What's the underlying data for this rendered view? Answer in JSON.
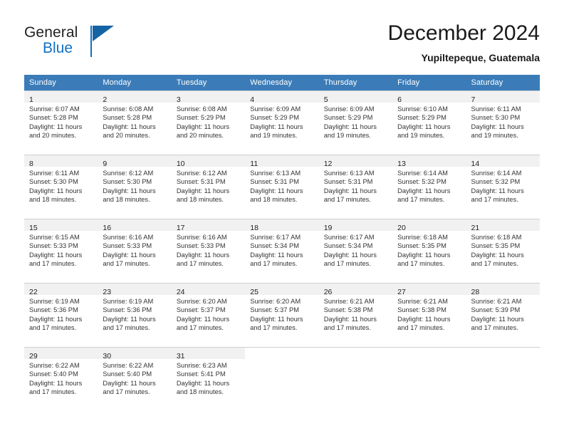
{
  "brand": {
    "name_top": "General",
    "name_bottom": "Blue",
    "accent_color": "#1170c0",
    "triangle_color": "#1464a5"
  },
  "header": {
    "title": "December 2024",
    "subtitle": "Yupiltepeque, Guatemala"
  },
  "calendar": {
    "header_color": "#3b7cb8",
    "daynum_band_color": "#f1f1f1",
    "weekday_headers": [
      "Sunday",
      "Monday",
      "Tuesday",
      "Wednesday",
      "Thursday",
      "Friday",
      "Saturday"
    ],
    "weeks": [
      [
        {
          "day": "1",
          "sunrise": "Sunrise: 6:07 AM",
          "sunset": "Sunset: 5:28 PM",
          "daylight_line1": "Daylight: 11 hours",
          "daylight_line2": "and 20 minutes."
        },
        {
          "day": "2",
          "sunrise": "Sunrise: 6:08 AM",
          "sunset": "Sunset: 5:28 PM",
          "daylight_line1": "Daylight: 11 hours",
          "daylight_line2": "and 20 minutes."
        },
        {
          "day": "3",
          "sunrise": "Sunrise: 6:08 AM",
          "sunset": "Sunset: 5:29 PM",
          "daylight_line1": "Daylight: 11 hours",
          "daylight_line2": "and 20 minutes."
        },
        {
          "day": "4",
          "sunrise": "Sunrise: 6:09 AM",
          "sunset": "Sunset: 5:29 PM",
          "daylight_line1": "Daylight: 11 hours",
          "daylight_line2": "and 19 minutes."
        },
        {
          "day": "5",
          "sunrise": "Sunrise: 6:09 AM",
          "sunset": "Sunset: 5:29 PM",
          "daylight_line1": "Daylight: 11 hours",
          "daylight_line2": "and 19 minutes."
        },
        {
          "day": "6",
          "sunrise": "Sunrise: 6:10 AM",
          "sunset": "Sunset: 5:29 PM",
          "daylight_line1": "Daylight: 11 hours",
          "daylight_line2": "and 19 minutes."
        },
        {
          "day": "7",
          "sunrise": "Sunrise: 6:11 AM",
          "sunset": "Sunset: 5:30 PM",
          "daylight_line1": "Daylight: 11 hours",
          "daylight_line2": "and 19 minutes."
        }
      ],
      [
        {
          "day": "8",
          "sunrise": "Sunrise: 6:11 AM",
          "sunset": "Sunset: 5:30 PM",
          "daylight_line1": "Daylight: 11 hours",
          "daylight_line2": "and 18 minutes."
        },
        {
          "day": "9",
          "sunrise": "Sunrise: 6:12 AM",
          "sunset": "Sunset: 5:30 PM",
          "daylight_line1": "Daylight: 11 hours",
          "daylight_line2": "and 18 minutes."
        },
        {
          "day": "10",
          "sunrise": "Sunrise: 6:12 AM",
          "sunset": "Sunset: 5:31 PM",
          "daylight_line1": "Daylight: 11 hours",
          "daylight_line2": "and 18 minutes."
        },
        {
          "day": "11",
          "sunrise": "Sunrise: 6:13 AM",
          "sunset": "Sunset: 5:31 PM",
          "daylight_line1": "Daylight: 11 hours",
          "daylight_line2": "and 18 minutes."
        },
        {
          "day": "12",
          "sunrise": "Sunrise: 6:13 AM",
          "sunset": "Sunset: 5:31 PM",
          "daylight_line1": "Daylight: 11 hours",
          "daylight_line2": "and 17 minutes."
        },
        {
          "day": "13",
          "sunrise": "Sunrise: 6:14 AM",
          "sunset": "Sunset: 5:32 PM",
          "daylight_line1": "Daylight: 11 hours",
          "daylight_line2": "and 17 minutes."
        },
        {
          "day": "14",
          "sunrise": "Sunrise: 6:14 AM",
          "sunset": "Sunset: 5:32 PM",
          "daylight_line1": "Daylight: 11 hours",
          "daylight_line2": "and 17 minutes."
        }
      ],
      [
        {
          "day": "15",
          "sunrise": "Sunrise: 6:15 AM",
          "sunset": "Sunset: 5:33 PM",
          "daylight_line1": "Daylight: 11 hours",
          "daylight_line2": "and 17 minutes."
        },
        {
          "day": "16",
          "sunrise": "Sunrise: 6:16 AM",
          "sunset": "Sunset: 5:33 PM",
          "daylight_line1": "Daylight: 11 hours",
          "daylight_line2": "and 17 minutes."
        },
        {
          "day": "17",
          "sunrise": "Sunrise: 6:16 AM",
          "sunset": "Sunset: 5:33 PM",
          "daylight_line1": "Daylight: 11 hours",
          "daylight_line2": "and 17 minutes."
        },
        {
          "day": "18",
          "sunrise": "Sunrise: 6:17 AM",
          "sunset": "Sunset: 5:34 PM",
          "daylight_line1": "Daylight: 11 hours",
          "daylight_line2": "and 17 minutes."
        },
        {
          "day": "19",
          "sunrise": "Sunrise: 6:17 AM",
          "sunset": "Sunset: 5:34 PM",
          "daylight_line1": "Daylight: 11 hours",
          "daylight_line2": "and 17 minutes."
        },
        {
          "day": "20",
          "sunrise": "Sunrise: 6:18 AM",
          "sunset": "Sunset: 5:35 PM",
          "daylight_line1": "Daylight: 11 hours",
          "daylight_line2": "and 17 minutes."
        },
        {
          "day": "21",
          "sunrise": "Sunrise: 6:18 AM",
          "sunset": "Sunset: 5:35 PM",
          "daylight_line1": "Daylight: 11 hours",
          "daylight_line2": "and 17 minutes."
        }
      ],
      [
        {
          "day": "22",
          "sunrise": "Sunrise: 6:19 AM",
          "sunset": "Sunset: 5:36 PM",
          "daylight_line1": "Daylight: 11 hours",
          "daylight_line2": "and 17 minutes."
        },
        {
          "day": "23",
          "sunrise": "Sunrise: 6:19 AM",
          "sunset": "Sunset: 5:36 PM",
          "daylight_line1": "Daylight: 11 hours",
          "daylight_line2": "and 17 minutes."
        },
        {
          "day": "24",
          "sunrise": "Sunrise: 6:20 AM",
          "sunset": "Sunset: 5:37 PM",
          "daylight_line1": "Daylight: 11 hours",
          "daylight_line2": "and 17 minutes."
        },
        {
          "day": "25",
          "sunrise": "Sunrise: 6:20 AM",
          "sunset": "Sunset: 5:37 PM",
          "daylight_line1": "Daylight: 11 hours",
          "daylight_line2": "and 17 minutes."
        },
        {
          "day": "26",
          "sunrise": "Sunrise: 6:21 AM",
          "sunset": "Sunset: 5:38 PM",
          "daylight_line1": "Daylight: 11 hours",
          "daylight_line2": "and 17 minutes."
        },
        {
          "day": "27",
          "sunrise": "Sunrise: 6:21 AM",
          "sunset": "Sunset: 5:38 PM",
          "daylight_line1": "Daylight: 11 hours",
          "daylight_line2": "and 17 minutes."
        },
        {
          "day": "28",
          "sunrise": "Sunrise: 6:21 AM",
          "sunset": "Sunset: 5:39 PM",
          "daylight_line1": "Daylight: 11 hours",
          "daylight_line2": "and 17 minutes."
        }
      ],
      [
        {
          "day": "29",
          "sunrise": "Sunrise: 6:22 AM",
          "sunset": "Sunset: 5:40 PM",
          "daylight_line1": "Daylight: 11 hours",
          "daylight_line2": "and 17 minutes."
        },
        {
          "day": "30",
          "sunrise": "Sunrise: 6:22 AM",
          "sunset": "Sunset: 5:40 PM",
          "daylight_line1": "Daylight: 11 hours",
          "daylight_line2": "and 17 minutes."
        },
        {
          "day": "31",
          "sunrise": "Sunrise: 6:23 AM",
          "sunset": "Sunset: 5:41 PM",
          "daylight_line1": "Daylight: 11 hours",
          "daylight_line2": "and 18 minutes."
        },
        null,
        null,
        null,
        null
      ]
    ]
  }
}
